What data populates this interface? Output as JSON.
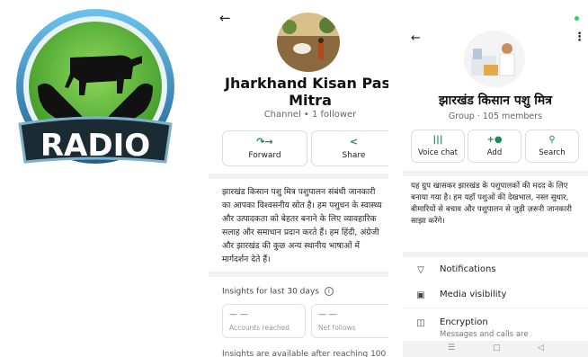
{
  "logo": {
    "text": "RADIO",
    "colors": {
      "ring": "#3a8fcc",
      "green": "#6cc043",
      "banner": "#1b2b33",
      "text": "#ffffff"
    }
  },
  "channel": {
    "back_icon": "arrow-left-icon",
    "name_line1": "Jharkhand Kisan Pashu",
    "name_line2": "Mitra",
    "subtitle": "Channel • 1 follower",
    "actions": [
      {
        "label": "Forward",
        "icon": "forward-icon"
      },
      {
        "label": "Share",
        "icon": "share-icon"
      }
    ],
    "description": "झारखंड किसान पशु मित्र पशुपालन संबंधी जानकारी का आपका विश्वसनीय स्रोत है। हम पशुधन के स्वास्थ्य और उत्पादकता को बेहतर बनाने के लिए व्यावहारिक सलाह और समाधान प्रदान करते हैं। हम हिंदी, अंग्रेजी और झारखंड की कुछ अन्य स्थानीय भाषाओं में मार्गदर्शन देते हैं।",
    "insights_title": "Insights for last 30 days",
    "cards": [
      {
        "value": "— —",
        "label": "Accounts reached"
      },
      {
        "value": "— —",
        "label": "Net follows"
      }
    ],
    "footer_text": "Insights are available after reaching 100"
  },
  "group": {
    "back_icon": "arrow-left-icon",
    "more_icon": "more-vert-icon",
    "name": "झारखंड किसान पशु मित्र",
    "subtitle": "Group · 105 members",
    "actions": [
      {
        "label": "Voice chat",
        "icon": "voice-chat-icon"
      },
      {
        "label": "Add",
        "icon": "add-person-icon"
      },
      {
        "label": "Search",
        "icon": "search-icon"
      }
    ],
    "description": "यह ग्रुप खासकर झारखंड के पशुपालकों की मदद के लिए बनाया गया है। हम यहाँ पशुओं की देखभाल, नस्ल सुधार, बीमारियों से बचाव और पशुपालन से जुड़ी ज़रूरी जानकारी साझा करेंगे।",
    "settings": [
      {
        "label": "Notifications",
        "icon": "bell-icon"
      },
      {
        "label": "Media visibility",
        "icon": "image-icon"
      },
      {
        "label": "Encryption",
        "sub": "Messages and calls are",
        "icon": "lock-icon"
      }
    ],
    "accent": "#1b8a55"
  }
}
